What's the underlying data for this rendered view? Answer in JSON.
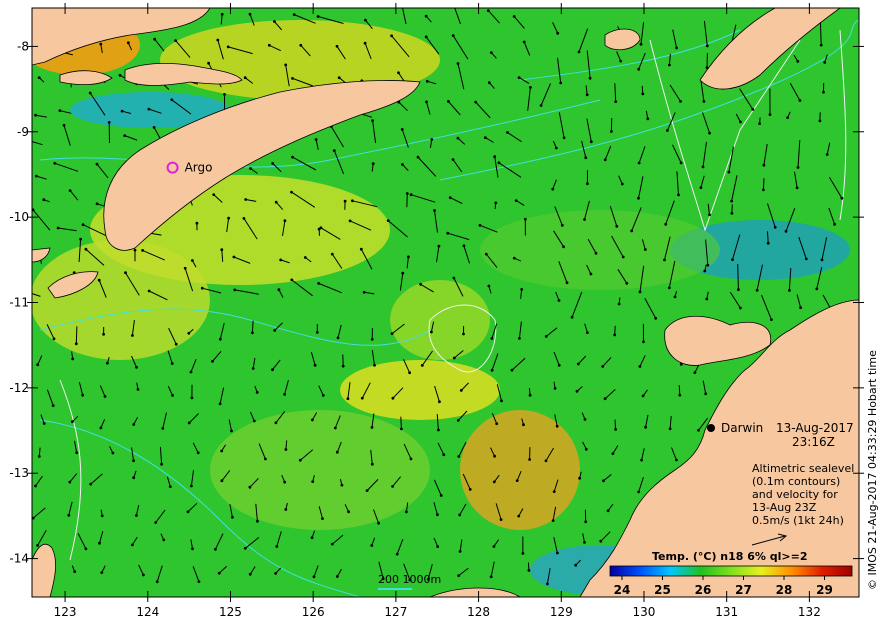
{
  "map": {
    "lon_range": [
      122.6,
      132.6
    ],
    "lat_range": [
      -14.45,
      -7.55
    ],
    "lon_ticks": [
      "123",
      "124",
      "125",
      "126",
      "127",
      "128",
      "129",
      "130",
      "131",
      "132"
    ],
    "lat_ticks": [
      "-8",
      "-9",
      "-10",
      "-11",
      "-12",
      "-13",
      "-14"
    ],
    "colors": {
      "land": "#f7c8a0",
      "sea": "#28c828",
      "contour": "#40e0e0",
      "argo": "#e020e0"
    }
  },
  "argo": {
    "label": "Argo",
    "lon": 124.3,
    "lat": -9.42
  },
  "darwin": {
    "label": "Darwin",
    "date": "13-Aug-2017",
    "time": "23:16Z"
  },
  "legend": {
    "lines": [
      "Altimetric sealevel",
      "(0.1m contours)",
      "and velocity for",
      "13-Aug 23Z",
      "0.5m/s (1kt 24h)"
    ]
  },
  "scale_bar": {
    "label": "200  1000m"
  },
  "colorbar": {
    "title": "Temp. (°C) n18 6% ql>=2",
    "ticks": [
      "24",
      "25",
      "26",
      "27",
      "28",
      "29"
    ],
    "stops": [
      "#0000a0",
      "#0050ff",
      "#00c8ff",
      "#20c020",
      "#80e020",
      "#e8f020",
      "#ff9000",
      "#e02000",
      "#a00000"
    ]
  },
  "credit": "© IMOS 21-Aug-2017 04:33:29 Hobart time"
}
